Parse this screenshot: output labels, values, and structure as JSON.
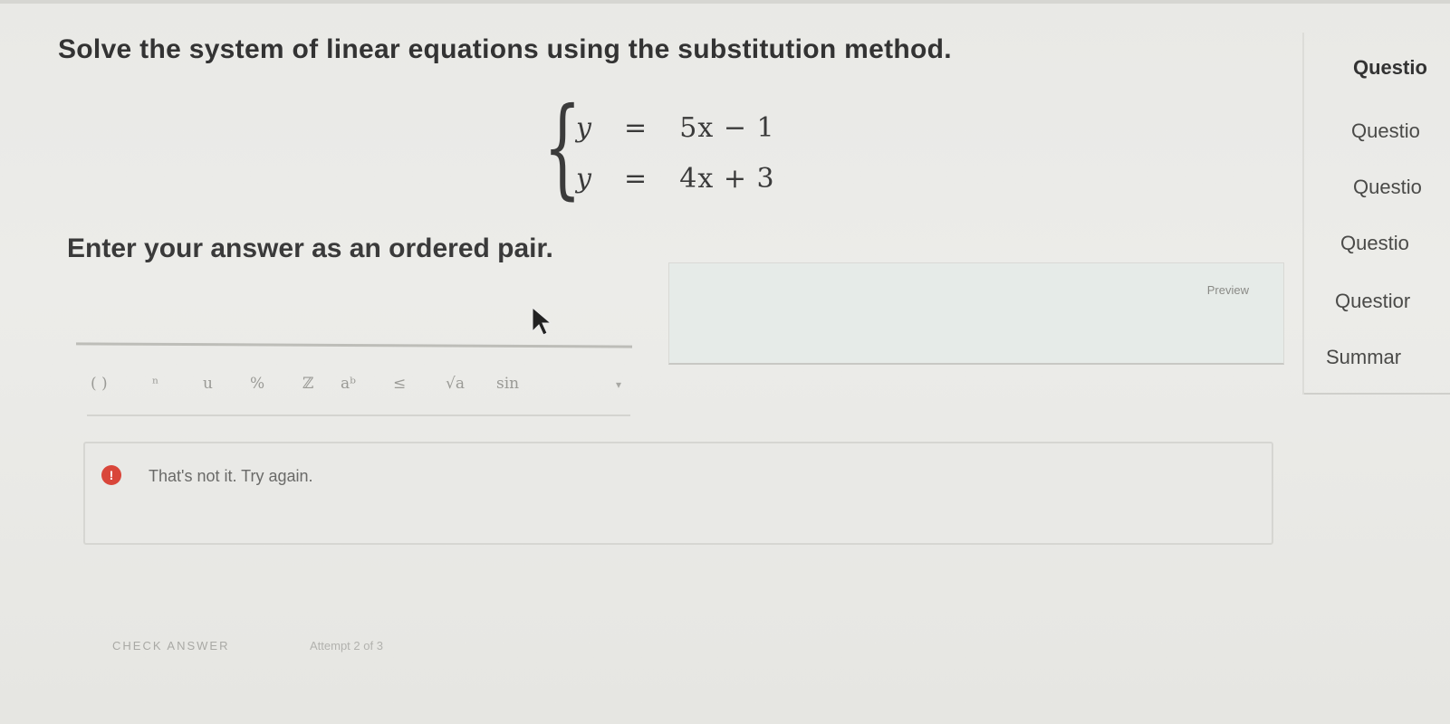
{
  "question": {
    "prompt": "Solve the system of linear equations using the substitution method.",
    "equations": [
      {
        "lhs": "y",
        "op": "=",
        "rhs": "5x − 1"
      },
      {
        "lhs": "y",
        "op": "=",
        "rhs": "4x + 3"
      }
    ],
    "instruction": "Enter your answer as an ordered pair."
  },
  "editor": {
    "preview_label": "Preview",
    "toolbar": [
      {
        "icon": "paren-icon",
        "label": "( )"
      },
      {
        "icon": "superscript-icon",
        "label": "ⁿ"
      },
      {
        "icon": "u-icon",
        "label": "u"
      },
      {
        "icon": "fraction-icon",
        "label": "%"
      },
      {
        "icon": "integer-icon",
        "label": "ℤ"
      },
      {
        "icon": "exponent-icon",
        "label": "aᵇ"
      },
      {
        "icon": "less-than-icon",
        "label": "≤"
      },
      {
        "icon": "sqrt-icon",
        "label": "√a"
      },
      {
        "icon": "sin-icon",
        "label": "sin"
      }
    ],
    "dropdown_icon": "chevron-down-icon"
  },
  "feedback": {
    "icon": "error-icon",
    "message": "That's not it. Try again."
  },
  "actions": {
    "check_label": "CHECK ANSWER",
    "attempt_text": "Attempt 2 of 3"
  },
  "sidebar": {
    "items": [
      "Questio",
      "Questio",
      "Questio",
      "Questio",
      "Questior",
      "Summar"
    ]
  },
  "colors": {
    "error": "#d9463a",
    "preview_bg": "#e6ebe8"
  }
}
